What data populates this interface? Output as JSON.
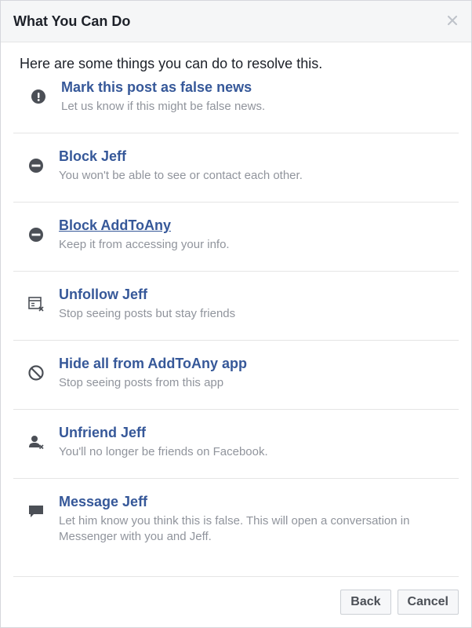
{
  "dialog": {
    "title": "What You Can Do",
    "intro": "Here are some things you can do to resolve this.",
    "close_icon": "close-icon"
  },
  "options": [
    {
      "icon": "exclamation-icon",
      "title": "Mark this post as false news",
      "desc": "Let us know if this might be false news."
    },
    {
      "icon": "minus-circle-icon",
      "title": "Block Jeff",
      "desc": "You won't be able to see or contact each other."
    },
    {
      "icon": "minus-circle-icon",
      "title": "Block AddToAny",
      "desc": "Keep it from accessing your info."
    },
    {
      "icon": "unfollow-icon",
      "title": "Unfollow Jeff",
      "desc": "Stop seeing posts but stay friends"
    },
    {
      "icon": "prohibited-icon",
      "title": "Hide all from AddToAny app",
      "desc": "Stop seeing posts from this app"
    },
    {
      "icon": "unfriend-icon",
      "title": "Unfriend Jeff",
      "desc": "You'll no longer be friends on Facebook."
    },
    {
      "icon": "message-icon",
      "title": "Message Jeff",
      "desc": "Let him know you think this is false. This will open a conversation in Messenger with you and Jeff."
    }
  ],
  "footer": {
    "back_label": "Back",
    "cancel_label": "Cancel"
  },
  "colors": {
    "link": "#365899",
    "muted": "#90949c",
    "icon": "#4b4f56",
    "header_bg": "#f5f6f7"
  }
}
